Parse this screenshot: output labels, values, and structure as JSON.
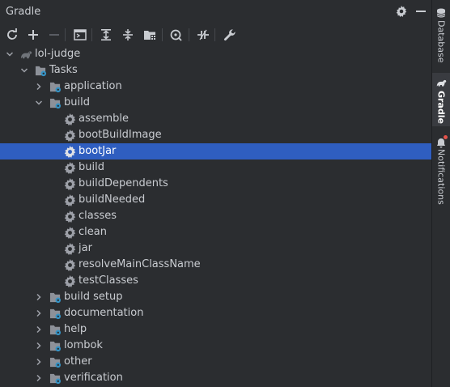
{
  "panel": {
    "title": "Gradle"
  },
  "header_icons": [
    "gear-icon",
    "minimize-icon"
  ],
  "toolbar": {
    "buttons": [
      "reload-icon",
      "add-icon",
      "remove-icon",
      "run-task-icon",
      "expand-all-icon",
      "collapse-all-icon",
      "group-modules-icon",
      "analyze-dependencies-icon",
      "toggle-offline-icon",
      "settings-wrench-icon"
    ]
  },
  "tree": {
    "project": "lol-judge",
    "tasks_node": "Tasks",
    "groups": {
      "application": "application",
      "build": "build",
      "build_setup": "build setup",
      "documentation": "documentation",
      "help": "help",
      "lombok": "lombok",
      "other": "other",
      "verification": "verification"
    },
    "build_tasks": [
      "assemble",
      "bootBuildImage",
      "bootJar",
      "build",
      "buildDependents",
      "buildNeeded",
      "classes",
      "clean",
      "jar",
      "resolveMainClassName",
      "testClasses"
    ],
    "selected_task": "bootJar"
  },
  "side_stripe": {
    "database": "Database",
    "gradle": "Gradle",
    "notifications": "Notifications"
  },
  "colors": {
    "background": "#2b2d30",
    "selection": "#2f5ec0",
    "text": "#c9ccd1",
    "notification_badge": "#e5534b"
  }
}
